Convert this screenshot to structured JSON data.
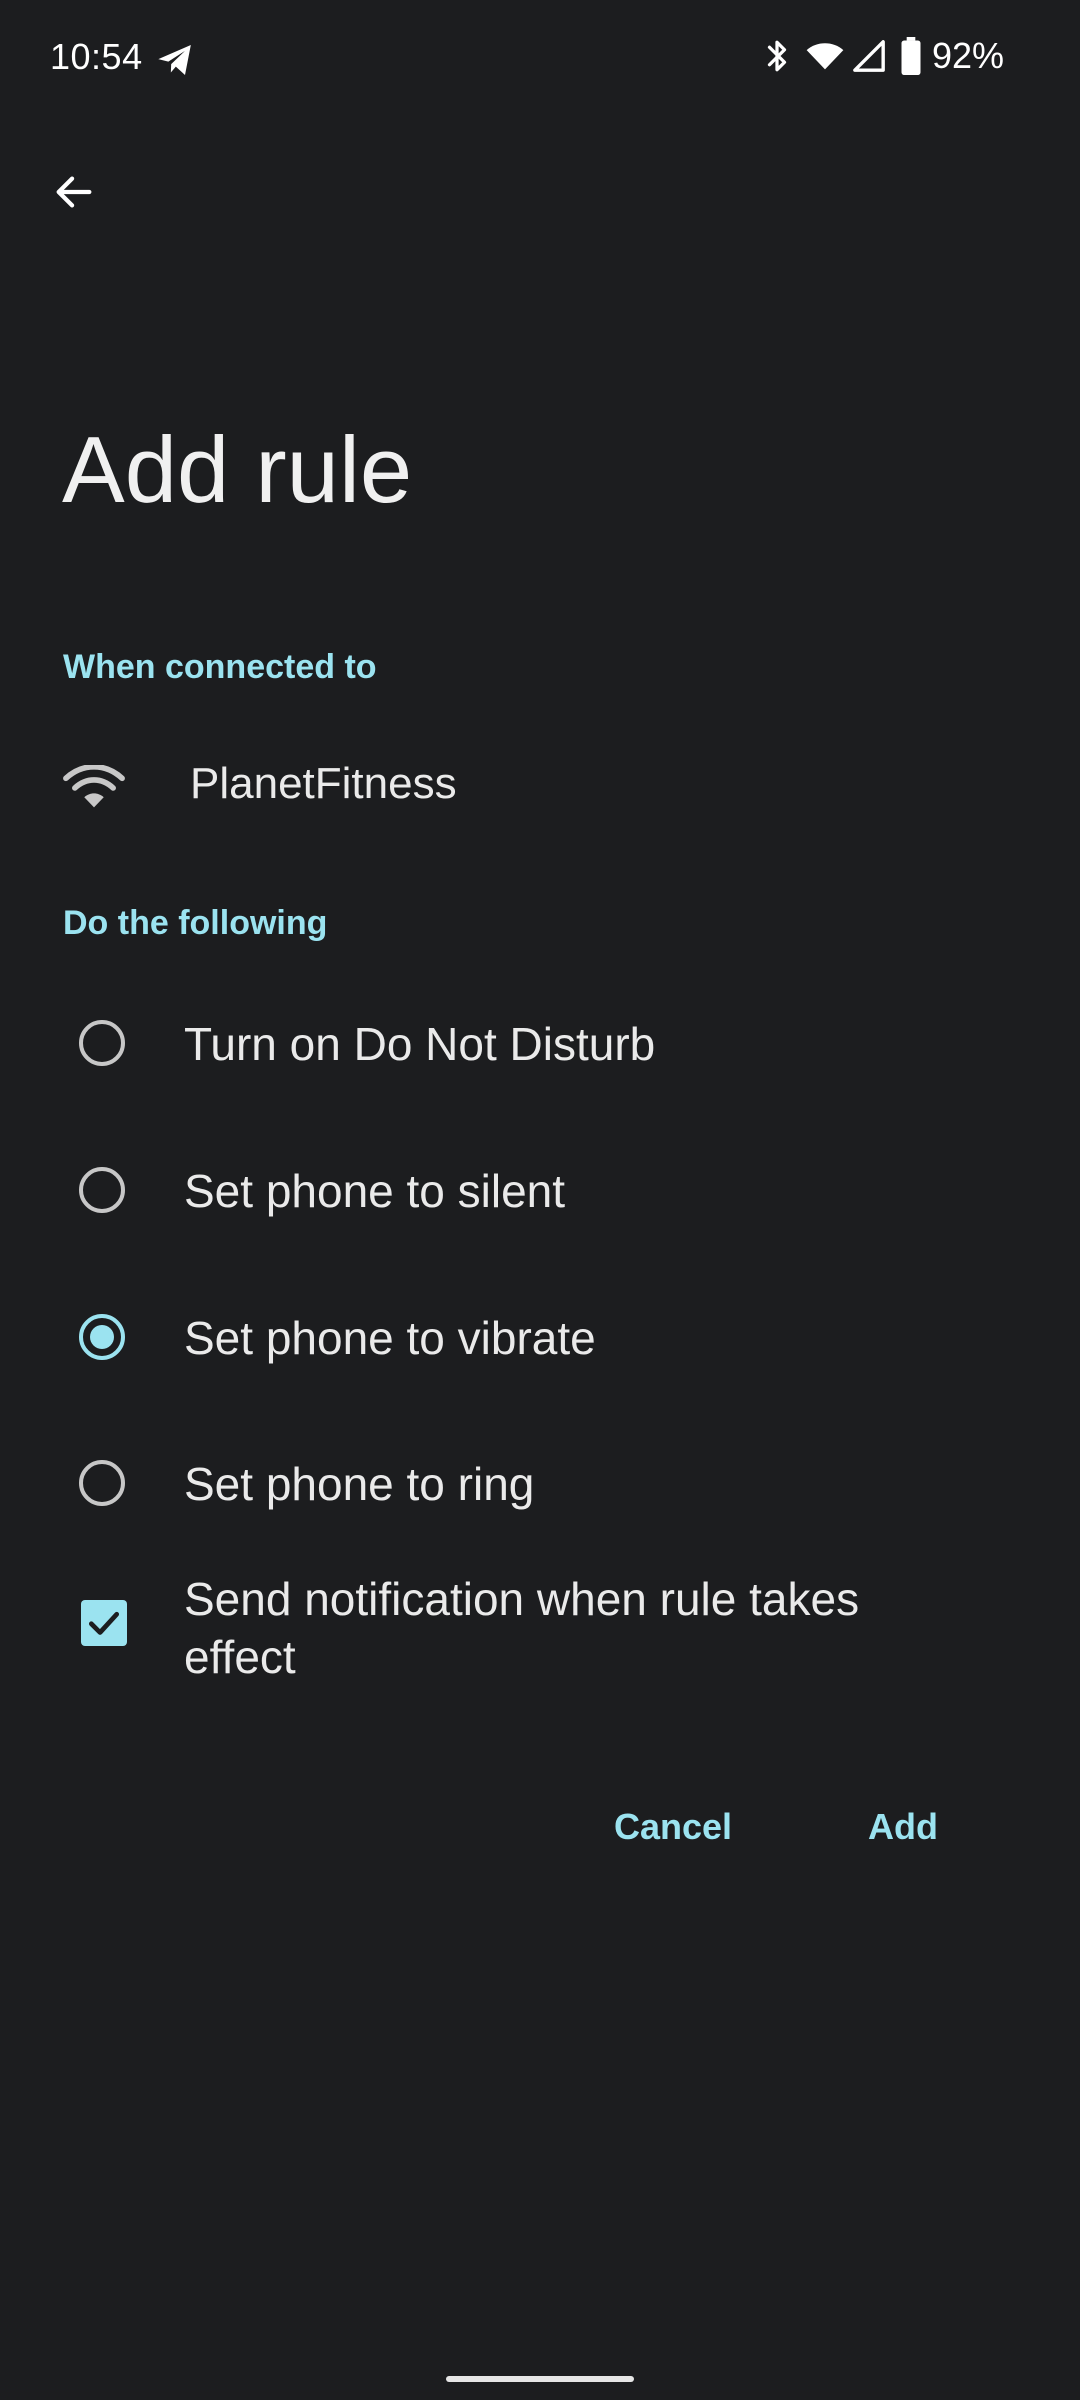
{
  "status_bar": {
    "time": "10:54",
    "battery_percent": "92%",
    "icons": [
      "telegram-icon",
      "bluetooth-icon",
      "wifi-signal-icon",
      "cell-signal-icon",
      "battery-icon"
    ]
  },
  "header": {
    "back_icon": "arrow-back-icon",
    "title": "Add rule"
  },
  "connected_section": {
    "header": "When connected to",
    "network_icon": "wifi-icon",
    "network_name": "PlanetFitness"
  },
  "actions_section": {
    "header": "Do the following",
    "options": [
      {
        "label": "Turn on Do Not Disturb",
        "selected": false
      },
      {
        "label": "Set phone to silent",
        "selected": false
      },
      {
        "label": "Set phone to vibrate",
        "selected": true
      },
      {
        "label": "Set phone to ring",
        "selected": false
      }
    ],
    "notification_checkbox": {
      "label": "Send notification when rule takes effect",
      "checked": true
    }
  },
  "buttons": {
    "cancel": "Cancel",
    "add": "Add"
  },
  "colors": {
    "background": "#1c1d1f",
    "accent": "#9be3f0",
    "text": "#eaeaea"
  }
}
